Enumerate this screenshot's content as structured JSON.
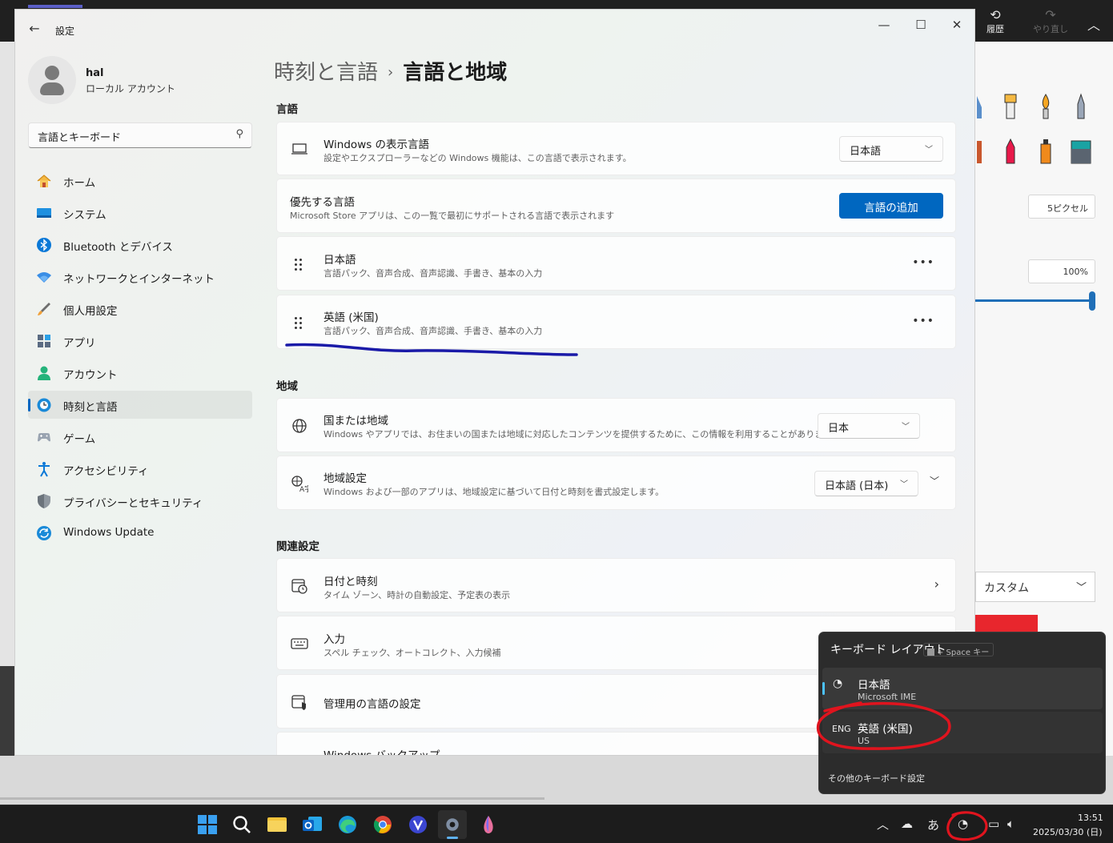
{
  "background_app": {
    "history_label": "履歴",
    "redo_label": "やり直し",
    "size_value": "5ピクセル",
    "opacity_value": "100%",
    "palette_select": "カスタム"
  },
  "window": {
    "title": "設定",
    "minimize_icon": "minimize-icon",
    "maximize_icon": "maximize-icon",
    "close_icon": "close-icon"
  },
  "user": {
    "name": "hal",
    "account_type": "ローカル アカウント"
  },
  "search": {
    "value": "言語とキーボード"
  },
  "nav": [
    {
      "label": "ホーム",
      "icon": "home-icon",
      "selected": false
    },
    {
      "label": "システム",
      "icon": "system-icon",
      "selected": false
    },
    {
      "label": "Bluetooth とデバイス",
      "icon": "bluetooth-icon",
      "selected": false
    },
    {
      "label": "ネットワークとインターネット",
      "icon": "network-icon",
      "selected": false
    },
    {
      "label": "個人用設定",
      "icon": "personalization-icon",
      "selected": false
    },
    {
      "label": "アプリ",
      "icon": "apps-icon",
      "selected": false
    },
    {
      "label": "アカウント",
      "icon": "accounts-icon",
      "selected": false
    },
    {
      "label": "時刻と言語",
      "icon": "time-language-icon",
      "selected": true
    },
    {
      "label": "ゲーム",
      "icon": "gaming-icon",
      "selected": false
    },
    {
      "label": "アクセシビリティ",
      "icon": "accessibility-icon",
      "selected": false
    },
    {
      "label": "プライバシーとセキュリティ",
      "icon": "privacy-icon",
      "selected": false
    },
    {
      "label": "Windows Update",
      "icon": "windows-update-icon",
      "selected": false
    }
  ],
  "breadcrumb": {
    "parent": "時刻と言語",
    "separator": "›",
    "current": "言語と地域"
  },
  "language_section": {
    "title": "言語",
    "display_language": {
      "title": "Windows の表示言語",
      "description": "設定やエクスプローラーなどの Windows 機能は、この言語で表示されます。",
      "value": "日本語"
    },
    "preferred": {
      "title": "優先する言語",
      "description": "Microsoft Store アプリは、この一覧で最初にサポートされる言語で表示されます",
      "add_button": "言語の追加"
    },
    "languages": [
      {
        "name": "日本語",
        "features": "言語パック、音声合成、音声認識、手書き、基本の入力"
      },
      {
        "name": "英語 (米国)",
        "features": "言語パック、音声合成、音声認識、手書き、基本の入力"
      }
    ]
  },
  "region_section": {
    "title": "地域",
    "country": {
      "title": "国または地域",
      "description": "Windows やアプリでは、お住まいの国または地域に対応したコンテンツを提供するために、この情報を利用することがあります",
      "value": "日本"
    },
    "format": {
      "title": "地域設定",
      "description": "Windows および一部のアプリは、地域設定に基づいて日付と時刻を書式設定します。",
      "value": "日本語 (日本)"
    }
  },
  "related_section": {
    "title": "関連設定",
    "items": [
      {
        "title": "日付と時刻",
        "description": "タイム ゾーン、時計の自動設定、予定表の表示"
      },
      {
        "title": "入力",
        "description": "スペル チェック、オートコレクト、入力候補"
      },
      {
        "title": "管理用の言語の設定",
        "description": ""
      },
      {
        "title": "Windows バックアップ",
        "description": ""
      }
    ]
  },
  "keyboard_flyout": {
    "title": "キーボード レイアウト",
    "shortcut": "+ Space キー",
    "options": [
      {
        "icon": "ime-icon",
        "code": "",
        "name": "日本語",
        "detail": "Microsoft IME",
        "selected": true
      },
      {
        "icon": "",
        "code": "ENG",
        "name": "英語 (米国)",
        "detail": "US",
        "selected": false
      }
    ],
    "more_settings": "その他のキーボード設定"
  },
  "taskbar": {
    "apps": [
      "start-icon",
      "search-icon",
      "file-explorer-icon",
      "outlook-icon",
      "edge-icon",
      "chrome-icon",
      "vivaldi-icon",
      "settings-icon",
      "paint-icon"
    ],
    "ime_mode": "あ",
    "time": "13:51",
    "date": "2025/03/30 (日)"
  },
  "colors": {
    "accent": "#0067c0",
    "annotation_blue": "#1a1aa8",
    "annotation_red": "#e0141e"
  }
}
